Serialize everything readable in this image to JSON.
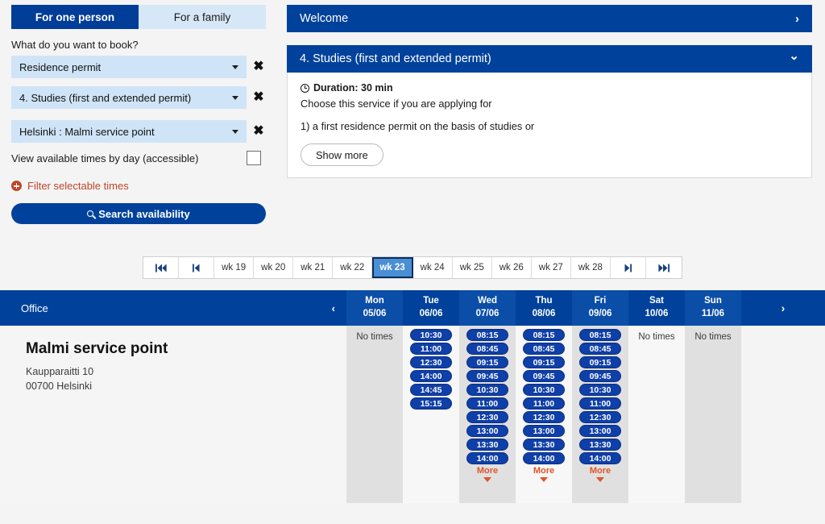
{
  "tabs": [
    {
      "label": "For one person",
      "active": true
    },
    {
      "label": "For a family",
      "active": false
    }
  ],
  "booking_form": {
    "question_label": "What do you want to book?",
    "selects": [
      {
        "name": "service-category",
        "value": "Residence permit",
        "clear_label": "✖"
      },
      {
        "name": "service-type",
        "value": "4. Studies (first and extended permit)",
        "clear_label": "✖"
      },
      {
        "name": "service-location",
        "value": "Helsinki : Malmi service point",
        "clear_label": "✖"
      }
    ],
    "accessible_checkbox_label": "View available times by day (accessible)",
    "filter_link_label": "Filter selectable times",
    "search_button_label": "Search availability"
  },
  "panels": {
    "welcome": {
      "title": "Welcome",
      "chevron": "›"
    },
    "service": {
      "title": "4. Studies (first and extended permit)",
      "chevron": "⌄",
      "duration": "Duration: 30 min",
      "line1": "Choose this service if you are applying for",
      "line2": "1) a first residence permit on the basis of studies or",
      "show_more_label": "Show more"
    }
  },
  "week_nav": {
    "first_label": "⏮",
    "prev_label": "⏴",
    "next_label": "⏵",
    "last_label": "⏭",
    "weeks": [
      {
        "label": "wk 19",
        "current": false
      },
      {
        "label": "wk 20",
        "current": false
      },
      {
        "label": "wk 21",
        "current": false
      },
      {
        "label": "wk 22",
        "current": false
      },
      {
        "label": "wk 23",
        "current": true
      },
      {
        "label": "wk 24",
        "current": false
      },
      {
        "label": "wk 25",
        "current": false
      },
      {
        "label": "wk 26",
        "current": false
      },
      {
        "label": "wk 27",
        "current": false
      },
      {
        "label": "wk 28",
        "current": false
      }
    ]
  },
  "calendar": {
    "office_header": "Office",
    "prev_week_arrow": "‹",
    "next_week_arrow": "›",
    "office": {
      "name": "Malmi service point",
      "street": "Kaupparaitti 10",
      "postal": "00700 Helsinki"
    },
    "no_times_label": "No times",
    "more_label": "More",
    "days": [
      {
        "weekday": "Mon",
        "date": "05/06",
        "shaded": true,
        "no_times": true,
        "times": [],
        "more": false
      },
      {
        "weekday": "Tue",
        "date": "06/06",
        "shaded": false,
        "no_times": false,
        "times": [
          "10:30",
          "11:00",
          "12:30",
          "14:00",
          "14:45",
          "15:15"
        ],
        "more": false
      },
      {
        "weekday": "Wed",
        "date": "07/06",
        "shaded": true,
        "no_times": false,
        "times": [
          "08:15",
          "08:45",
          "09:15",
          "09:45",
          "10:30",
          "11:00",
          "12:30",
          "13:00",
          "13:30",
          "14:00"
        ],
        "more": true
      },
      {
        "weekday": "Thu",
        "date": "08/06",
        "shaded": false,
        "no_times": false,
        "times": [
          "08:15",
          "08:45",
          "09:15",
          "09:45",
          "10:30",
          "11:00",
          "12:30",
          "13:00",
          "13:30",
          "14:00"
        ],
        "more": true
      },
      {
        "weekday": "Fri",
        "date": "09/06",
        "shaded": true,
        "no_times": false,
        "times": [
          "08:15",
          "08:45",
          "09:15",
          "09:45",
          "10:30",
          "11:00",
          "12:30",
          "13:00",
          "13:30",
          "14:00"
        ],
        "more": true
      },
      {
        "weekday": "Sat",
        "date": "10/06",
        "shaded": false,
        "no_times": true,
        "times": [],
        "more": false
      },
      {
        "weekday": "Sun",
        "date": "11/06",
        "shaded": true,
        "no_times": true,
        "times": [],
        "more": false
      }
    ]
  },
  "colors": {
    "brand_blue": "#00429b",
    "tab_active": "#003d99",
    "tab_inactive": "#d6e7f7",
    "select_bg": "#cfe4f7",
    "slot_blue": "#0f3fa8",
    "accent_red": "#c0462a",
    "more_orange": "#e0542a",
    "week_current": "#4a8fd4"
  }
}
